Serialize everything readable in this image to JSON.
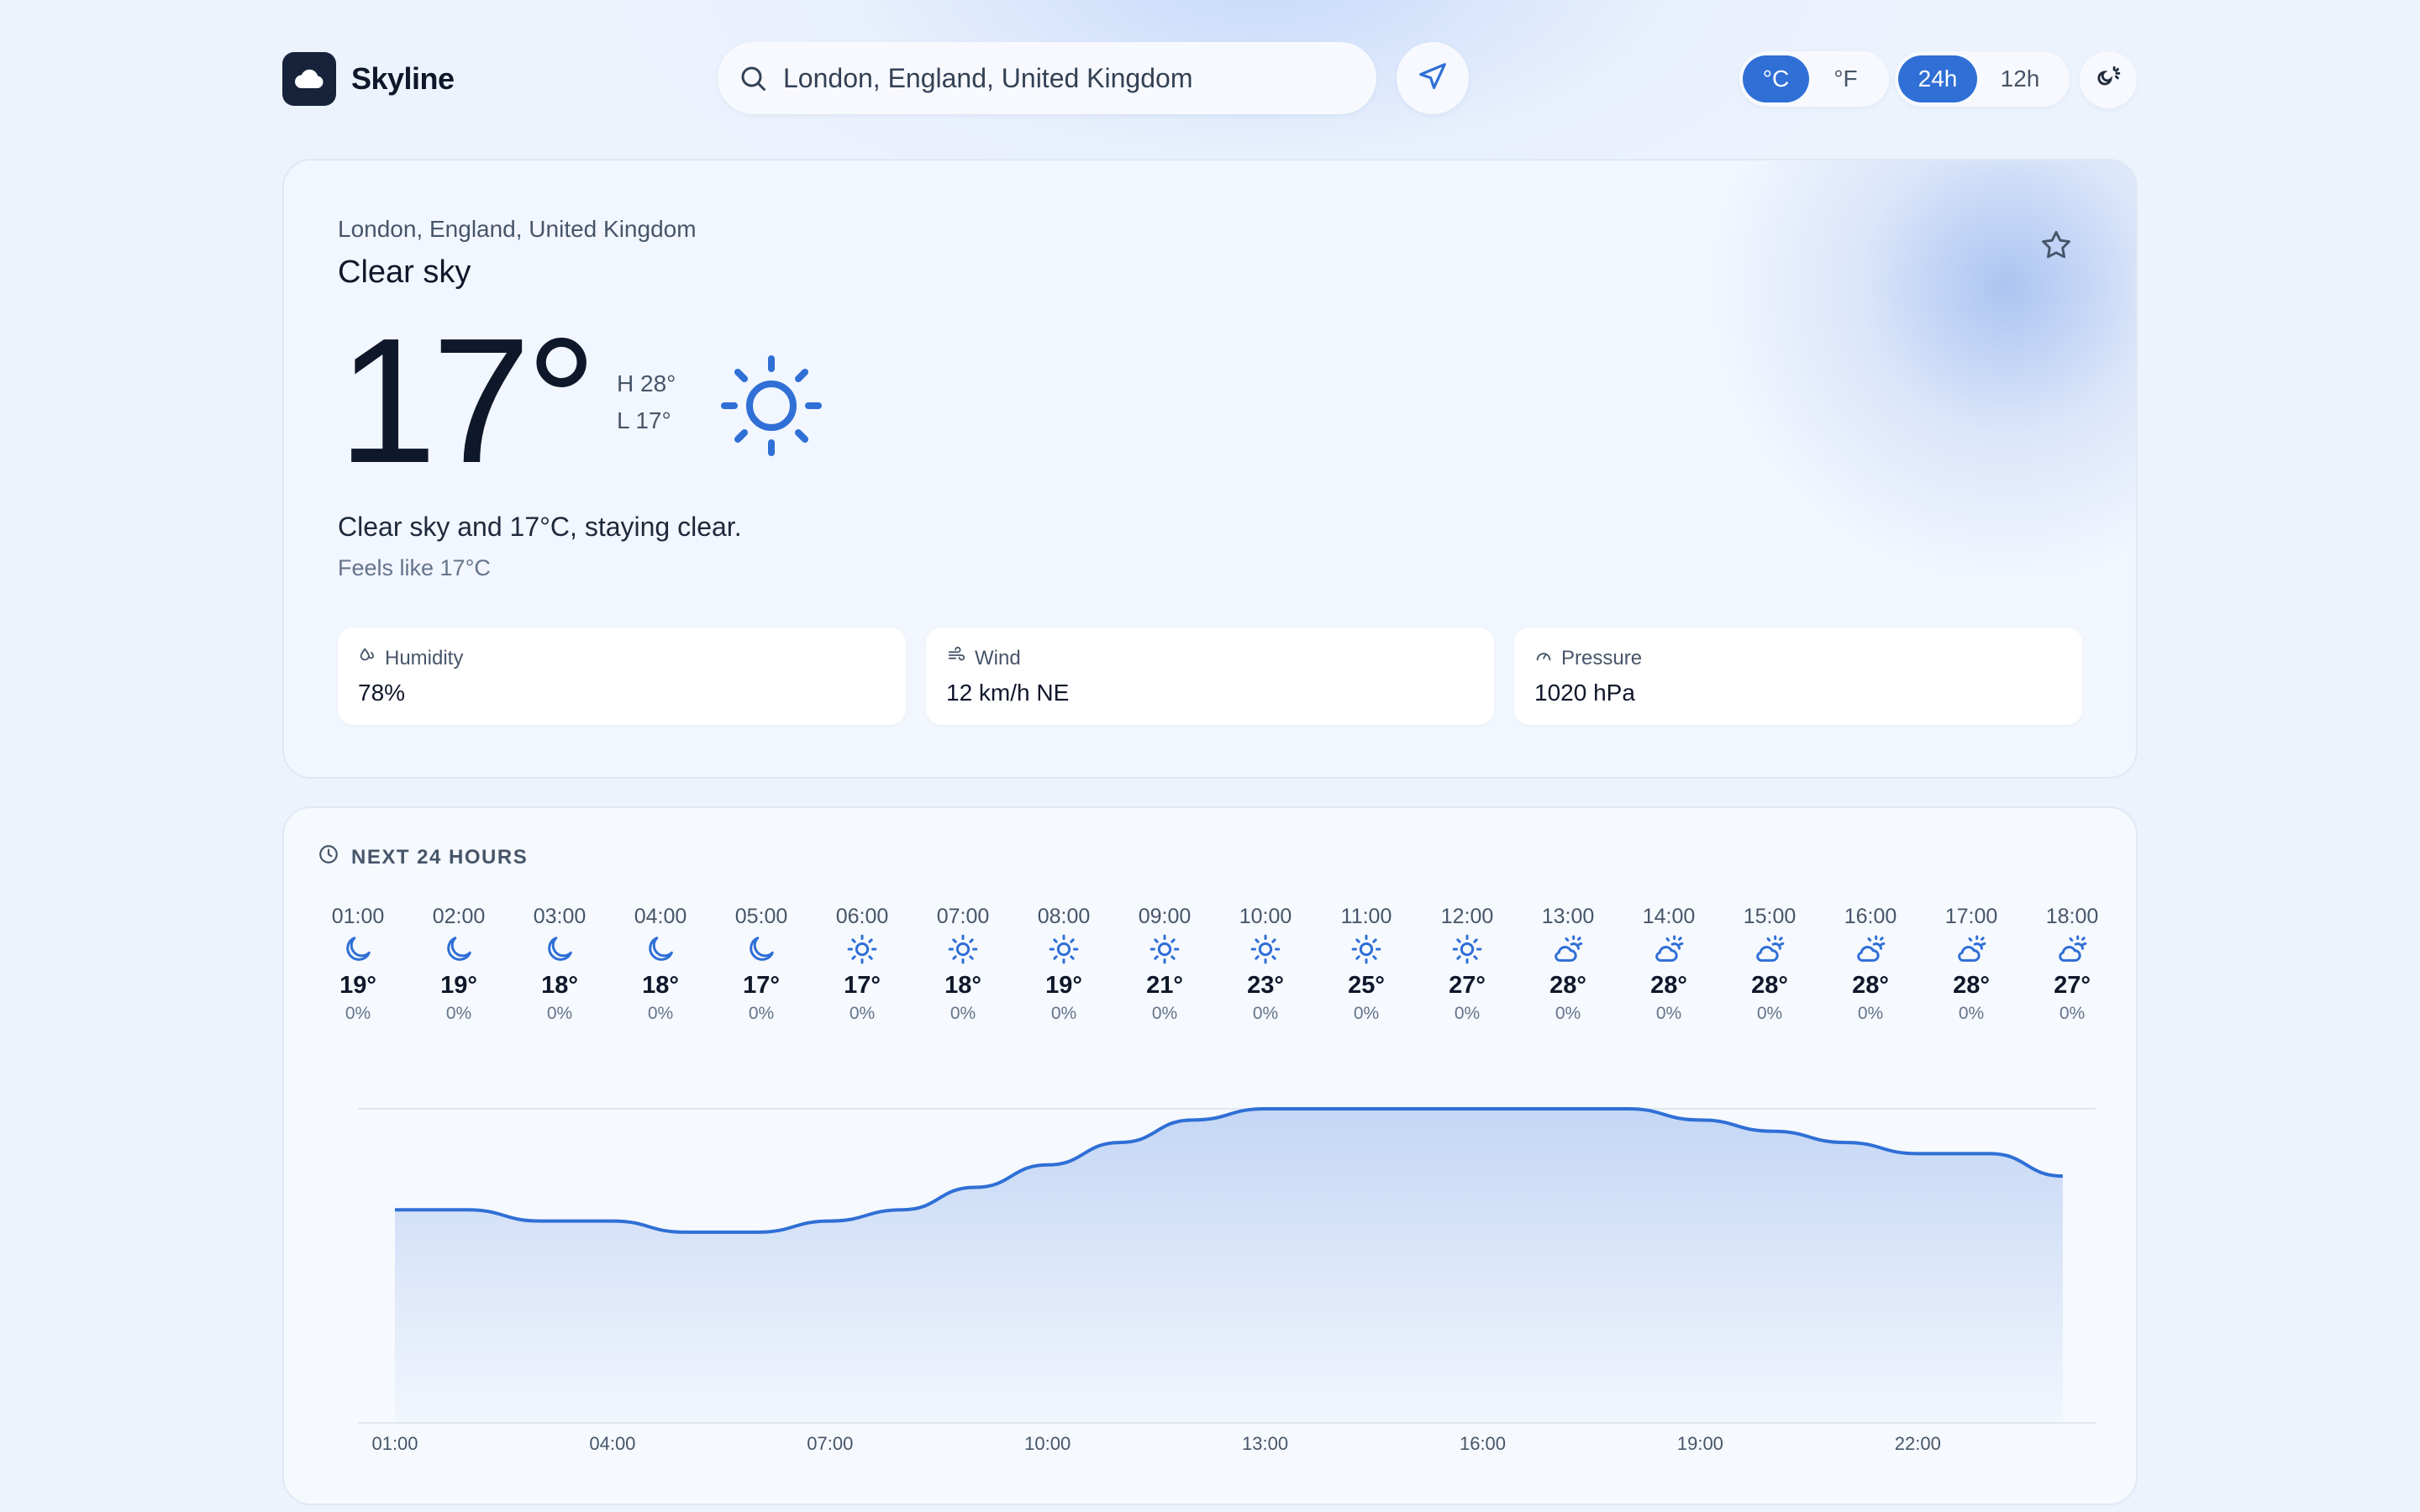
{
  "app": {
    "name": "Skyline"
  },
  "header": {
    "search": {
      "value": "London, England, United Kingdom",
      "placeholder": ""
    },
    "unit_toggle": {
      "options": [
        "°C",
        "°F"
      ],
      "selected": "°C"
    },
    "clock_toggle": {
      "options": [
        "24h",
        "12h"
      ],
      "selected": "24h"
    },
    "icons": {
      "search": "search-icon",
      "locate": "navigation-arrow-icon",
      "theme": "theme-toggle-icon"
    }
  },
  "current": {
    "location": "London, England, United Kingdom",
    "condition": "Clear sky",
    "temperature": "17°",
    "high": "H 28°",
    "low": "L 17°",
    "summary": "Clear sky and 17°C, staying clear.",
    "feels_like": "Feels like 17°C",
    "condition_icon": "sun-icon",
    "stats": [
      {
        "label": "Humidity",
        "value": "78%",
        "icon": "humidity-icon"
      },
      {
        "label": "Wind",
        "value": "12 km/h NE",
        "icon": "wind-icon"
      },
      {
        "label": "Pressure",
        "value": "1020 hPa",
        "icon": "gauge-icon"
      }
    ]
  },
  "forecast": {
    "title": "NEXT 24 HOURS",
    "hours": [
      {
        "time": "01:00",
        "icon": "moon",
        "temp": "19°",
        "pop": "0%"
      },
      {
        "time": "02:00",
        "icon": "moon",
        "temp": "19°",
        "pop": "0%"
      },
      {
        "time": "03:00",
        "icon": "moon",
        "temp": "18°",
        "pop": "0%"
      },
      {
        "time": "04:00",
        "icon": "moon",
        "temp": "18°",
        "pop": "0%"
      },
      {
        "time": "05:00",
        "icon": "moon",
        "temp": "17°",
        "pop": "0%"
      },
      {
        "time": "06:00",
        "icon": "sun",
        "temp": "17°",
        "pop": "0%"
      },
      {
        "time": "07:00",
        "icon": "sun",
        "temp": "18°",
        "pop": "0%"
      },
      {
        "time": "08:00",
        "icon": "sun",
        "temp": "19°",
        "pop": "0%"
      },
      {
        "time": "09:00",
        "icon": "sun",
        "temp": "21°",
        "pop": "0%"
      },
      {
        "time": "10:00",
        "icon": "sun",
        "temp": "23°",
        "pop": "0%"
      },
      {
        "time": "11:00",
        "icon": "sun",
        "temp": "25°",
        "pop": "0%"
      },
      {
        "time": "12:00",
        "icon": "sun",
        "temp": "27°",
        "pop": "0%"
      },
      {
        "time": "13:00",
        "icon": "partly-cloudy",
        "temp": "28°",
        "pop": "0%"
      },
      {
        "time": "14:00",
        "icon": "partly-cloudy",
        "temp": "28°",
        "pop": "0%"
      },
      {
        "time": "15:00",
        "icon": "partly-cloudy",
        "temp": "28°",
        "pop": "0%"
      },
      {
        "time": "16:00",
        "icon": "partly-cloudy",
        "temp": "28°",
        "pop": "0%"
      },
      {
        "time": "17:00",
        "icon": "partly-cloudy",
        "temp": "28°",
        "pop": "0%"
      },
      {
        "time": "18:00",
        "icon": "partly-cloudy",
        "temp": "27°",
        "pop": "0%"
      }
    ]
  },
  "chart_data": {
    "type": "area",
    "x": [
      "01:00",
      "02:00",
      "03:00",
      "04:00",
      "05:00",
      "06:00",
      "07:00",
      "08:00",
      "09:00",
      "10:00",
      "11:00",
      "12:00",
      "13:00",
      "14:00",
      "15:00",
      "16:00",
      "17:00",
      "18:00",
      "19:00",
      "20:00",
      "21:00",
      "22:00",
      "23:00",
      "00:00"
    ],
    "series": [
      {
        "values": [
          19,
          19,
          18,
          18,
          17,
          17,
          18,
          19,
          21,
          23,
          25,
          27,
          28,
          28,
          28,
          28,
          28,
          28,
          27,
          26,
          25,
          24,
          24,
          22
        ]
      }
    ],
    "xticks": [
      "01:00",
      "04:00",
      "07:00",
      "10:00",
      "13:00",
      "16:00",
      "19:00",
      "22:00"
    ],
    "ylim": [
      0,
      28
    ],
    "grid": "horizontal",
    "colors": {
      "line": "#2f6fd6",
      "fill": "#c2d5f4"
    }
  },
  "theme": {
    "accent": "#2f6fd6",
    "logo_bg": "#16233a"
  }
}
